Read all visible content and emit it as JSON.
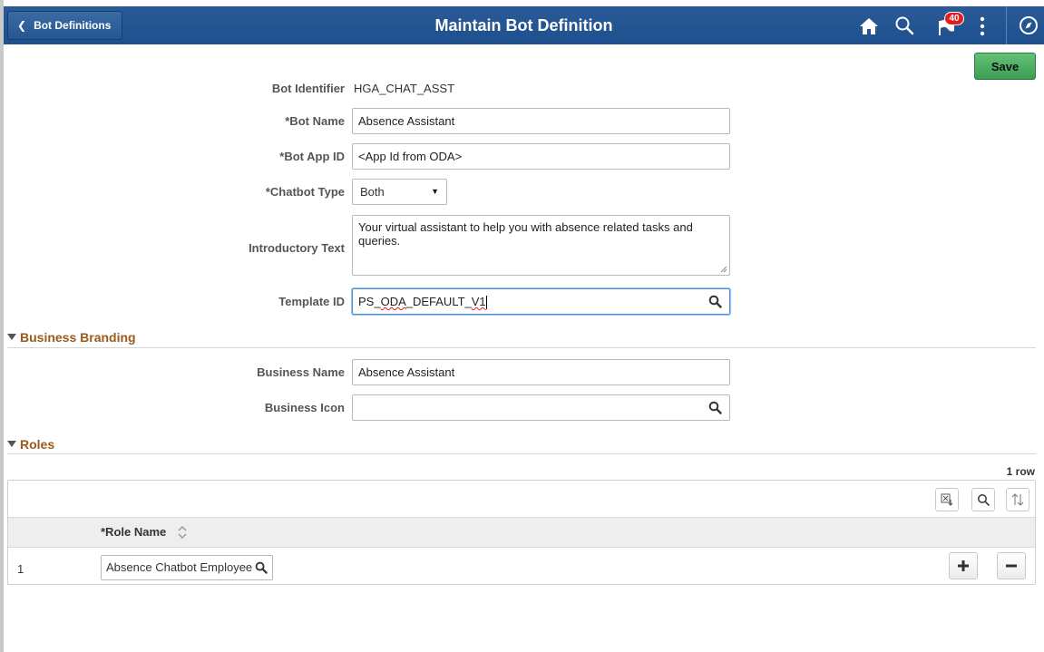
{
  "header": {
    "back_label": "Bot Definitions",
    "title": "Maintain Bot Definition",
    "notification_count": "40",
    "icons": [
      "home-icon",
      "search-icon",
      "flag-icon",
      "more-vertical-icon",
      "navbar-compass-icon"
    ]
  },
  "toolbar": {
    "save_label": "Save"
  },
  "form": {
    "bot_identifier": {
      "label": "Bot Identifier",
      "value": "HGA_CHAT_ASST"
    },
    "bot_name": {
      "label": "*Bot Name",
      "value": "Absence Assistant"
    },
    "bot_app_id": {
      "label": "*Bot App ID",
      "value": "<App Id from ODA>"
    },
    "chatbot_type": {
      "label": "*Chatbot Type",
      "value": "Both"
    },
    "introductory_text": {
      "label": "Introductory Text",
      "value": "Your virtual assistant to help you with absence related tasks and queries."
    },
    "template_id": {
      "label": "Template ID",
      "value_a": "PS_",
      "value_b": "ODA",
      "value_c": "_DEFAULT_",
      "value_d": "V1"
    }
  },
  "branding": {
    "section_title": "Business Branding",
    "business_name": {
      "label": "Business Name",
      "value": "Absence Assistant"
    },
    "business_icon": {
      "label": "Business Icon",
      "value": ""
    }
  },
  "roles": {
    "section_title": "Roles",
    "row_count": "1 row",
    "column_header": "*Role Name",
    "rows": [
      {
        "num": "1",
        "role_name": "Absence Chatbot Employee"
      }
    ]
  },
  "colors": {
    "header": "#1e4f8e",
    "save": "#3c9d52",
    "section": "#9b5a1a"
  }
}
